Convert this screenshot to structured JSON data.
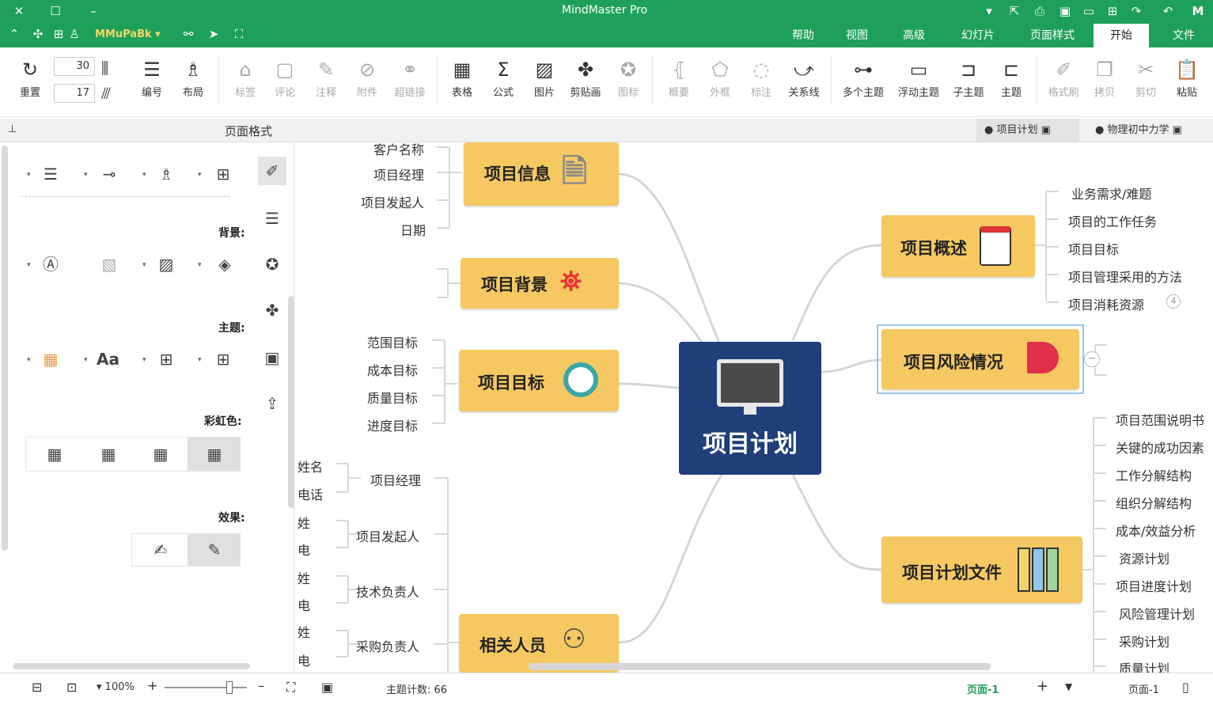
{
  "app": {
    "title": "MindMaster Pro",
    "user": "MMuPaBk"
  },
  "menu": {
    "tabs": [
      "文件",
      "开始",
      "页面样式",
      "幻灯片",
      "高级",
      "视图",
      "帮助"
    ],
    "active": "开始"
  },
  "ribbon": {
    "groups": [
      {
        "label": "粘贴"
      },
      {
        "label": "剪切"
      },
      {
        "label": "拷贝"
      },
      {
        "label": "格式刷"
      },
      {
        "label": "主题"
      },
      {
        "label": "子主题"
      },
      {
        "label": "浮动主题"
      },
      {
        "label": "多个主题"
      },
      {
        "label": "关系线"
      },
      {
        "label": "标注"
      },
      {
        "label": "外框"
      },
      {
        "label": "概要"
      },
      {
        "label": "图标"
      },
      {
        "label": "剪贴画"
      },
      {
        "label": "图片"
      },
      {
        "label": "公式"
      },
      {
        "label": "表格"
      },
      {
        "label": "超链接"
      },
      {
        "label": "附件"
      },
      {
        "label": "注释"
      },
      {
        "label": "评论"
      },
      {
        "label": "标签"
      },
      {
        "label": "布局"
      },
      {
        "label": "编号"
      },
      {
        "label": "重置"
      }
    ],
    "spin1": "30",
    "spin2": "17"
  },
  "tabs": {
    "doc1": "物理初中力学",
    "doc2": "项目计划"
  },
  "panel": {
    "title": "页面格式",
    "bg_label": "背景:",
    "theme_label": "主题:",
    "rainbow_label": "彩虹色:",
    "effect_label": "效果:"
  },
  "map": {
    "center": "项目计划",
    "left": [
      {
        "title": "项目信息",
        "subs": [
          "客户名称",
          "项目经理",
          "项目发起人",
          "日期"
        ]
      },
      {
        "title": "项目背景",
        "subs": []
      },
      {
        "title": "项目目标",
        "subs": [
          "范围目标",
          "成本目标",
          "质量目标",
          "进度目标"
        ]
      },
      {
        "title": "相关人员",
        "subs": [
          "项目经理",
          "项目发起人",
          "技术负责人",
          "采购负责人"
        ],
        "leaf": [
          "姓名",
          "电话",
          "姓",
          "电",
          "姓",
          "电",
          "姓",
          "电"
        ]
      }
    ],
    "right": [
      {
        "title": "项目概述",
        "subs": [
          "业务需求/难题",
          "项目的工作任务",
          "项目目标",
          "项目管理采用的方法",
          "项目消耗资源"
        ],
        "badge": "4"
      },
      {
        "title": "项目风险情况",
        "subs": []
      },
      {
        "title": "项目计划文件",
        "subs": [
          "项目范围说明书",
          "关键的成功因素",
          "工作分解结构",
          "组织分解结构",
          "成本/效益分析",
          "资源计划",
          "项目进度计划",
          "风险管理计划",
          "采购计划",
          "质量计划"
        ]
      }
    ]
  },
  "status": {
    "page_label": "页面-1",
    "page_tab": "页面-1",
    "topic_count": "主题计数: 66",
    "zoom": "100%"
  },
  "colors": {
    "brand": "#1fa05a",
    "topic": "#f5c862",
    "center": "#1e3f7a"
  }
}
